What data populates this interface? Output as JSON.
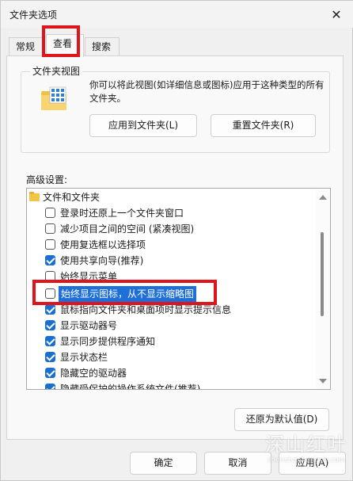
{
  "window": {
    "title": "文件夹选项",
    "close_glyph": "✕"
  },
  "tabs": [
    {
      "label": "常规"
    },
    {
      "label": "查看"
    },
    {
      "label": "搜索"
    }
  ],
  "folder_views": {
    "group_label": "文件夹视图",
    "description": "你可以将此视图(如详细信息或图标)应用于这种类型的所有文件夹。",
    "apply_button": "应用到文件夹(L)",
    "reset_button": "重置文件夹(R)"
  },
  "advanced": {
    "label": "高级设置:",
    "items": [
      {
        "label": "文件和文件夹",
        "kind": "folder"
      },
      {
        "label": "登录时还原上一个文件夹窗口",
        "checked": false
      },
      {
        "label": "减少项目之间的空间 (紧凑视图)",
        "checked": false
      },
      {
        "label": "使用复选框以选择项",
        "checked": false
      },
      {
        "label": "使用共享向导(推荐)",
        "checked": true
      },
      {
        "label": "始终显示菜单",
        "checked": false
      },
      {
        "label": "始终显示图标，从不显示缩略图",
        "checked": false,
        "selected": true
      },
      {
        "label": "鼠标指向文件夹和桌面项时显示提示信息",
        "checked": true
      },
      {
        "label": "显示驱动器号",
        "checked": true
      },
      {
        "label": "显示同步提供程序通知",
        "checked": true
      },
      {
        "label": "显示状态栏",
        "checked": true
      },
      {
        "label": "隐藏空的驱动器",
        "checked": true
      },
      {
        "label": "隐藏受保护的操作系统文件(推荐)",
        "checked": true
      }
    ],
    "restore_button": "还原为默认值(D)"
  },
  "footer": {
    "ok": "确定",
    "cancel": "取消",
    "apply": "应用(A)"
  },
  "watermark": {
    "main": "深山红叶",
    "sub": "shenshanhongye.com"
  },
  "colors": {
    "accent": "#1e70d8",
    "annotation": "#e0141d"
  }
}
